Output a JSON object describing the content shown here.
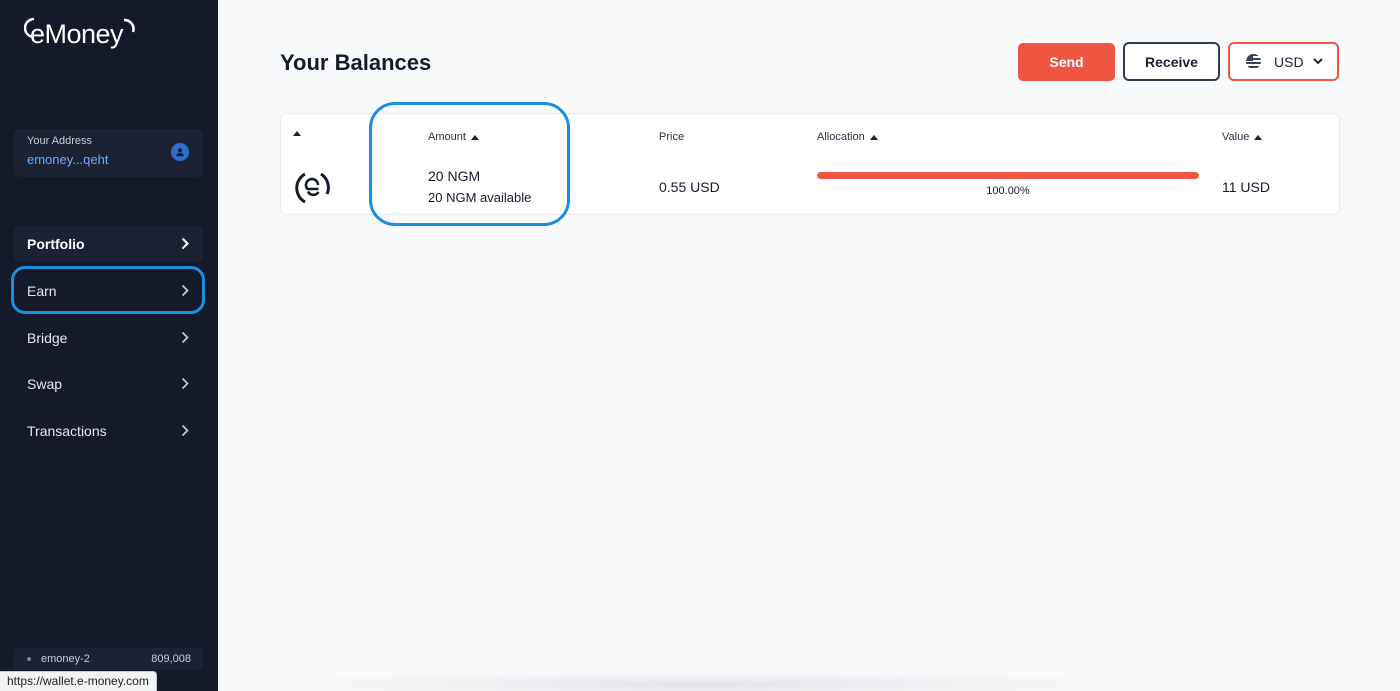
{
  "app": {
    "logo_text": "eMoney"
  },
  "sidebar": {
    "address_label": "Your Address",
    "address_value": "emoney...qeht",
    "items": [
      {
        "label": "Portfolio",
        "active": true
      },
      {
        "label": "Earn",
        "active": false
      },
      {
        "label": "Bridge",
        "active": false
      },
      {
        "label": "Swap",
        "active": false
      },
      {
        "label": "Transactions",
        "active": false
      }
    ],
    "network": {
      "name": "emoney-2",
      "block_height": "809,008"
    }
  },
  "header": {
    "title": "Your Balances",
    "send_label": "Send",
    "receive_label": "Receive",
    "currency_label": "USD"
  },
  "table": {
    "headers": {
      "amount": "Amount",
      "price": "Price",
      "allocation": "Allocation",
      "value": "Value"
    },
    "rows": [
      {
        "token_icon": "emoney-logo-icon",
        "amount": "20 NGM",
        "available": "20 NGM available",
        "price": "0.55 USD",
        "allocation_fraction": 1.0,
        "allocation_text": "100.00%",
        "value": "11 USD"
      }
    ]
  },
  "status_bar": {
    "url": "https://wallet.e-money.com"
  },
  "colors": {
    "accent": "#f05541",
    "sidebar_bg": "#141a2a",
    "highlight": "#1a8fe0",
    "link": "#6ea8ff"
  }
}
